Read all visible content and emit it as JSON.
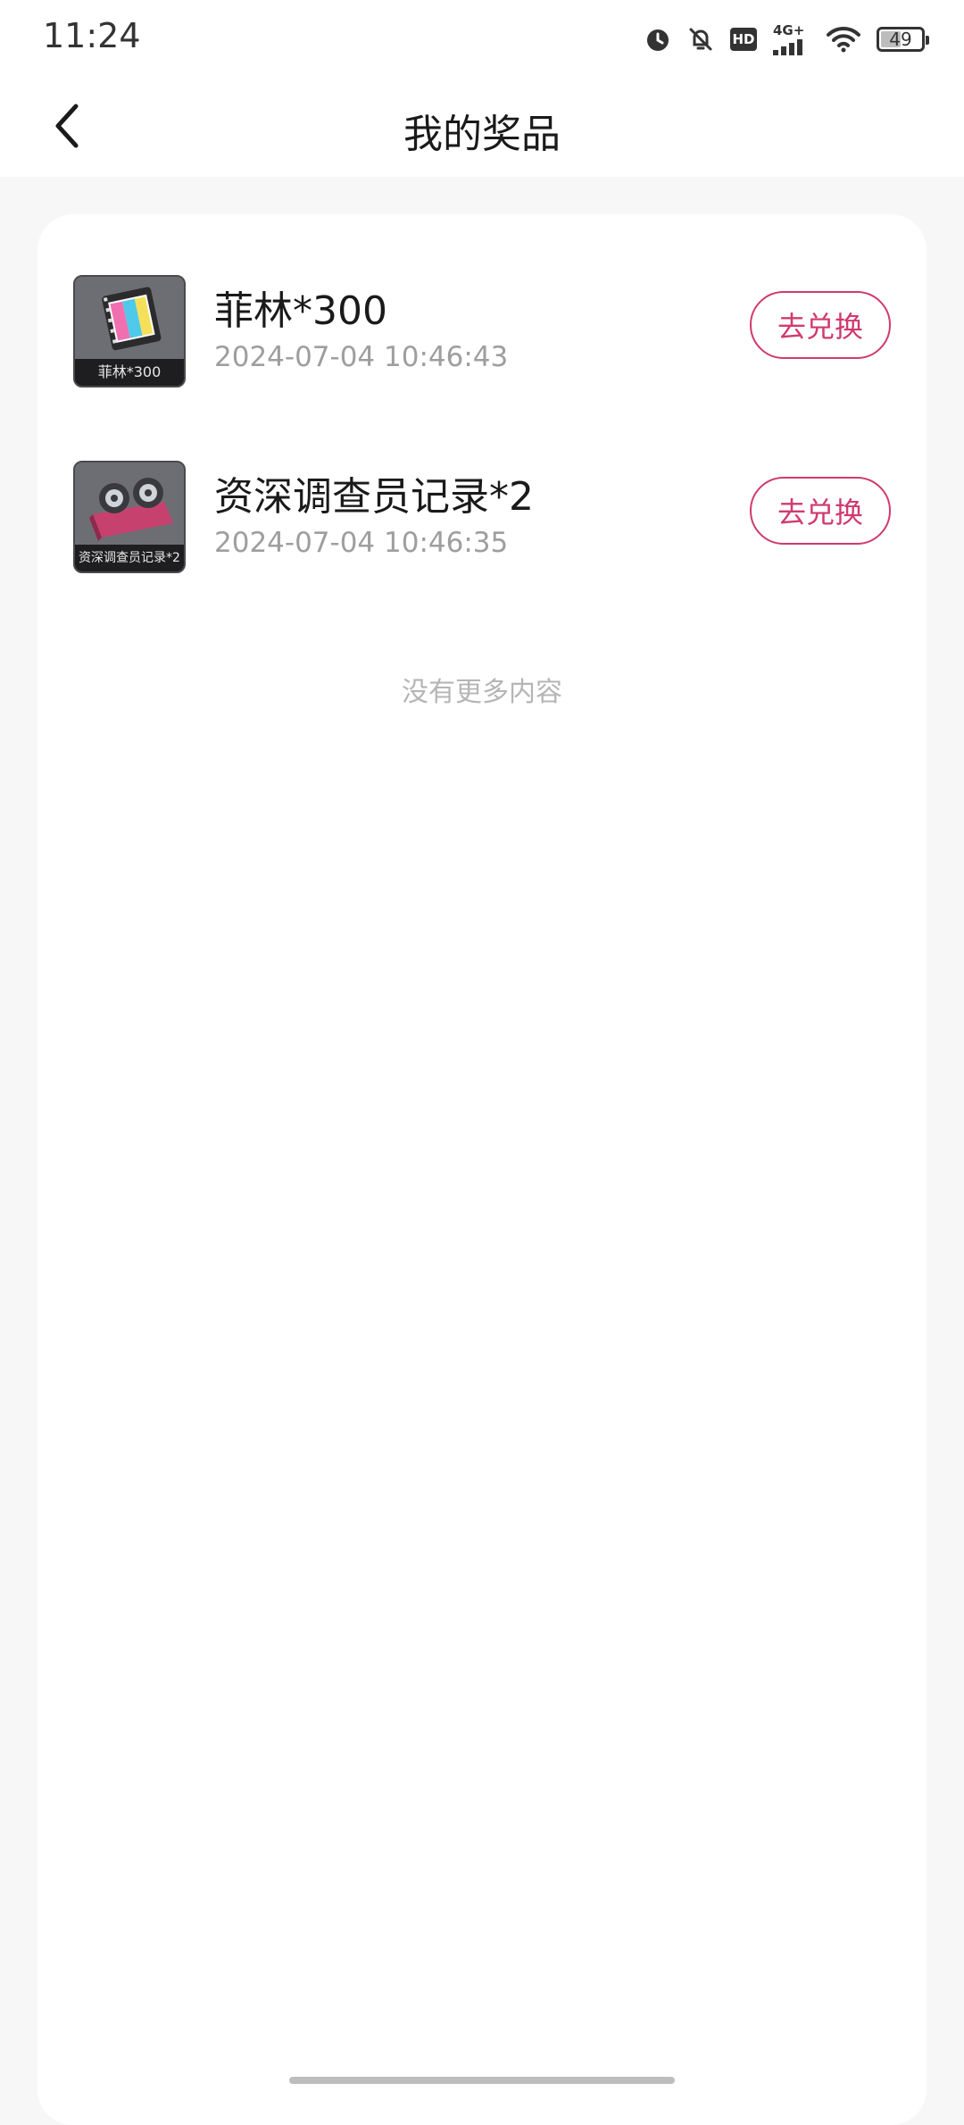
{
  "status_bar": {
    "time": "11:24",
    "network_label": "4G+",
    "hd_label": "HD",
    "battery_level": "49",
    "battery_fraction": 0.49,
    "icons": [
      "alarm-icon",
      "bell-off-icon",
      "hd-icon",
      "signal-icon",
      "wifi-icon",
      "battery-icon"
    ]
  },
  "header": {
    "title": "我的奖品",
    "back_icon": "chevron-left-icon"
  },
  "prizes": [
    {
      "name": "菲林*300",
      "date": "2024-07-04 10:46:43",
      "thumb_caption": "菲林*300",
      "button_label": "去兑换"
    },
    {
      "name": "资深调查员记录*2",
      "date": "2024-07-04 10:46:35",
      "thumb_caption": "资深调查员记录*2",
      "button_label": "去兑换"
    }
  ],
  "list_end_text": "没有更多内容",
  "colors": {
    "accent": "#d03a6f",
    "background": "#f7f7f7",
    "card": "#ffffff",
    "muted_text": "#9e9e9e"
  }
}
